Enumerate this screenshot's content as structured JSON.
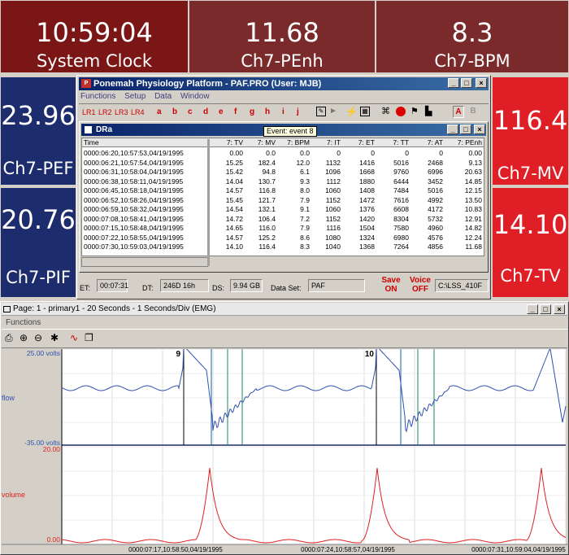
{
  "top_tiles": [
    {
      "value": "10:59:04",
      "label": "System Clock"
    },
    {
      "value": "11.68",
      "label": "Ch7-PEnh"
    },
    {
      "value": "8.3",
      "label": "Ch7-BPM"
    }
  ],
  "left_tiles": [
    {
      "value": "23.96",
      "label": "Ch7-PEF"
    },
    {
      "value": "20.76",
      "label": "Ch7-PIF"
    }
  ],
  "right_tiles": [
    {
      "value": "116.4",
      "label": "Ch7-MV"
    },
    {
      "value": "14.10",
      "label": "Ch7-TV"
    }
  ],
  "platform": {
    "title": "Ponemah Physiology Platform  - PAF.PRO (User: MJB)",
    "menus": [
      "Functions",
      "Setup",
      "Data",
      "Window"
    ],
    "lr_buttons": [
      "LR1",
      "LR2",
      "LR3",
      "LR4"
    ],
    "letters": [
      "a",
      "b",
      "c",
      "d",
      "e",
      "f",
      "g",
      "h",
      "i",
      "j"
    ],
    "ab": [
      "A",
      "B"
    ],
    "tooltip": "Event: event 8",
    "dra_title": "DRa",
    "columns": [
      "Time",
      "7:  TV",
      "7:  MV",
      "7:  BPM",
      "7:  IT",
      "7:  ET",
      "7:  TT",
      "7:  AT",
      "7:  PEnh"
    ],
    "rows": [
      [
        "0000:06:20,10:57:53,04/19/1995",
        "0.00",
        "0.0",
        "0.0",
        "0",
        "0",
        "0",
        "0",
        "0.00"
      ],
      [
        "0000:06:21,10:57:54,04/19/1995",
        "15.25",
        "182.4",
        "12.0",
        "1132",
        "1416",
        "5016",
        "2468",
        "9.13"
      ],
      [
        "0000:06:31,10:58:04,04/19/1995",
        "15.42",
        "94.8",
        "6.1",
        "1096",
        "1668",
        "9760",
        "6996",
        "20.63"
      ],
      [
        "0000:06:38,10:58:11,04/19/1995",
        "14.04",
        "130.7",
        "9.3",
        "1112",
        "1880",
        "6444",
        "3452",
        "14.85"
      ],
      [
        "0000:06:45,10:58:18,04/19/1995",
        "14.57",
        "116.8",
        "8.0",
        "1060",
        "1408",
        "7484",
        "5016",
        "12.15"
      ],
      [
        "0000:06:52,10:58:26,04/19/1995",
        "15.45",
        "121.7",
        "7.9",
        "1152",
        "1472",
        "7616",
        "4992",
        "13.50"
      ],
      [
        "0000:06:59,10:58:32,04/19/1995",
        "14.54",
        "132.1",
        "9.1",
        "1060",
        "1376",
        "6608",
        "4172",
        "10.83"
      ],
      [
        "0000:07:08,10:58:41,04/19/1995",
        "14.72",
        "106.4",
        "7.2",
        "1152",
        "1420",
        "8304",
        "5732",
        "12.91"
      ],
      [
        "0000:07:15,10:58:48,04/19/1995",
        "14.65",
        "116.0",
        "7.9",
        "1116",
        "1504",
        "7580",
        "4960",
        "14.82"
      ],
      [
        "0000:07:22,10:58:55,04/19/1995",
        "14.57",
        "125.2",
        "8.6",
        "1080",
        "1324",
        "6980",
        "4576",
        "12.24"
      ],
      [
        "0000:07:30,10:59:03,04/19/1995",
        "14.10",
        "116.4",
        "8.3",
        "1040",
        "1368",
        "7264",
        "4856",
        "11.68"
      ]
    ],
    "status": {
      "et_label": "ET:",
      "et_value": "00:07:31",
      "dt_label": "DT:",
      "dt_value": "246D 16h",
      "ds_label": "DS:",
      "ds_value": "9.94 GB",
      "dataset_label": "Data Set:",
      "dataset_value": "PAF",
      "save": "Save\nON",
      "voice": "Voice\nOFF",
      "path": "C:\\LSS_410F"
    }
  },
  "graph": {
    "title": "Page: 1 - primary1 - 20 Seconds - 1 Seconds/Div (EMG)",
    "menu": "Functions",
    "flow_label": "flow",
    "flow_max": "25.00 volts",
    "flow_min": "-35.00 volts",
    "volume_label": "volume",
    "volume_max": "20.00",
    "volume_min": "0.00",
    "marker_9": "9",
    "marker_10": "10",
    "time_labels": [
      "0000:07:17,10:58:50,04/19/1995",
      "0000:07:24,10:58:57,04/19/1995",
      "0000:07:31,10:59:04,04/19/1995"
    ],
    "colors": {
      "flow": "#3050b0",
      "volume": "#e02020",
      "accent_blue": "#1c2c6c",
      "accent_red": "#e01e26"
    }
  }
}
